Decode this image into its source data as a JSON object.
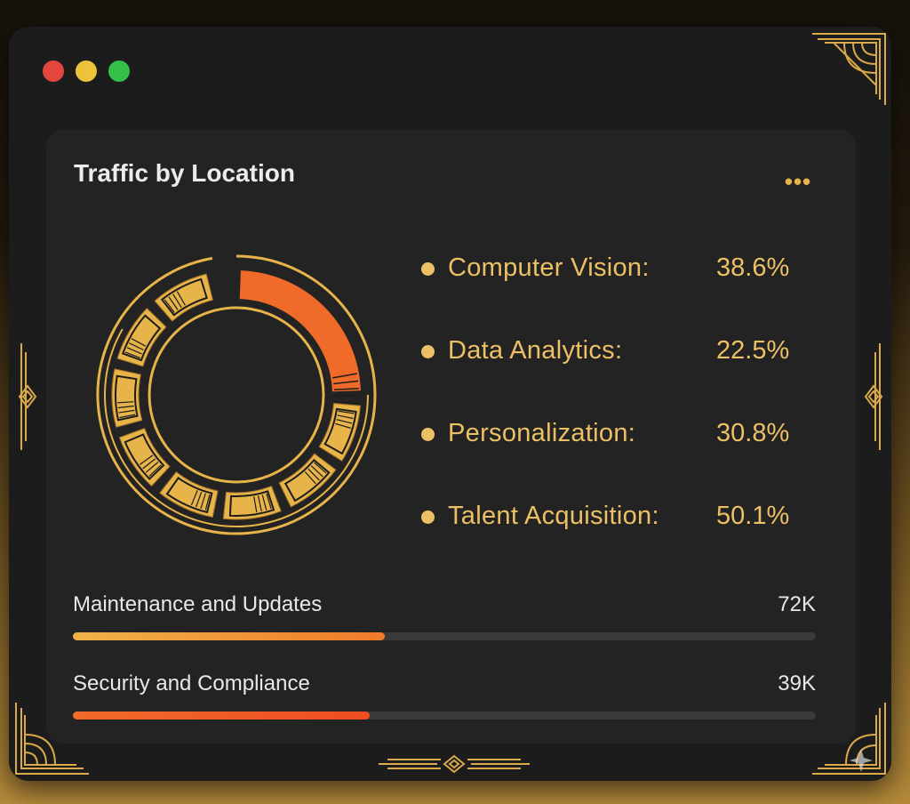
{
  "window": {
    "controls": [
      {
        "name": "close",
        "color": "#e2463f"
      },
      {
        "name": "minimize",
        "color": "#eec239"
      },
      {
        "name": "maximize",
        "color": "#35c04a"
      }
    ]
  },
  "card": {
    "title": "Traffic by Location",
    "menu_icon": "more-horizontal-icon"
  },
  "legend": [
    {
      "label": "Computer Vision:",
      "value": "38.6%"
    },
    {
      "label": "Data Analytics:",
      "value": "22.5%"
    },
    {
      "label": "Personalization:",
      "value": "30.8%"
    },
    {
      "label": "Talent Acquisition:",
      "value": "50.1%"
    }
  ],
  "donut": {
    "highlight_color": "#f06a2a",
    "segment_color": "#e7b44a"
  },
  "progress": [
    {
      "label": "Maintenance and Updates",
      "value": "72K",
      "fill": 0.42,
      "color_from": "#f0b347",
      "color_to": "#f07a2a"
    },
    {
      "label": "Security and Compliance",
      "value": "39K",
      "fill": 0.4,
      "color_from": "#f06a2a",
      "color_to": "#ee4d22"
    }
  ],
  "colors": {
    "accent": "#ecc064",
    "gold": "#d9a94a",
    "orange": "#f06a2a"
  }
}
